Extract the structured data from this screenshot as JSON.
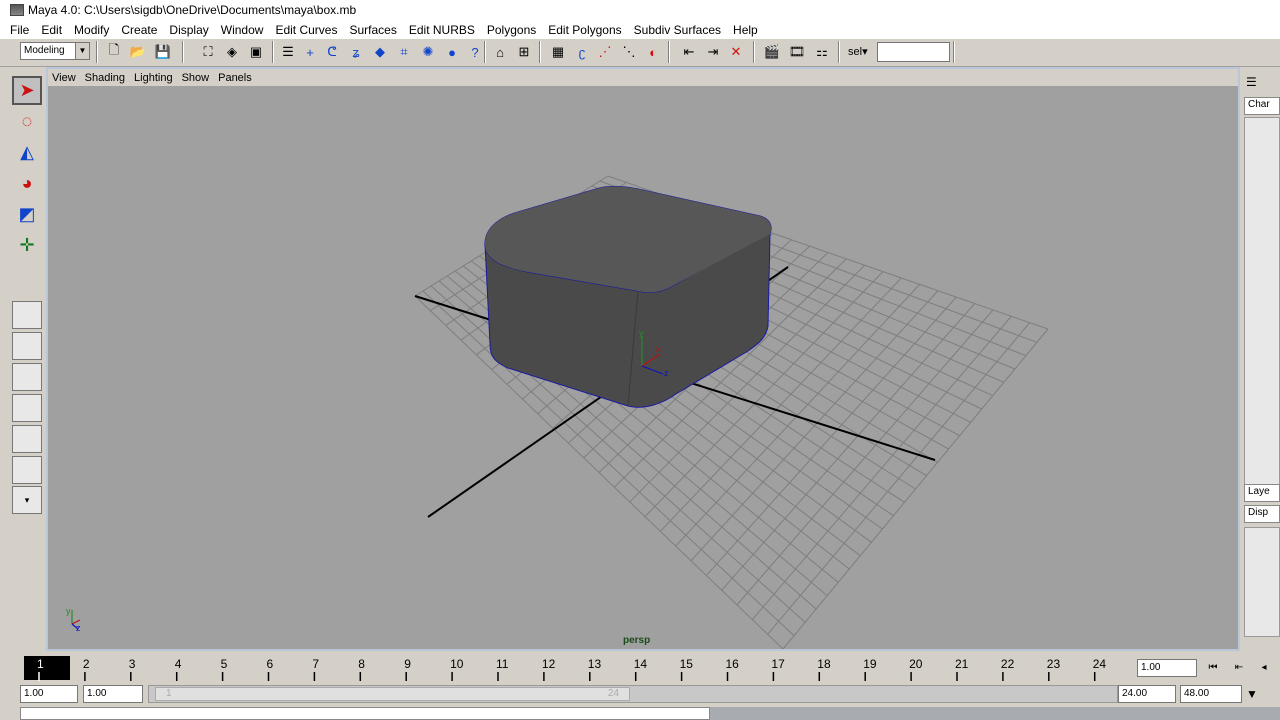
{
  "window": {
    "title": "Maya 4.0: C:\\Users\\sigdb\\OneDrive\\Documents\\maya\\box.mb"
  },
  "menubar": [
    "File",
    "Edit",
    "Modify",
    "Create",
    "Display",
    "Window",
    "Edit Curves",
    "Surfaces",
    "Edit NURBS",
    "Polygons",
    "Edit Polygons",
    "Subdiv Surfaces",
    "Help"
  ],
  "shelf": {
    "mode": "Modeling",
    "sel_label": "sel",
    "sel_value": ""
  },
  "panel_menu": [
    "View",
    "Shading",
    "Lighting",
    "Show",
    "Panels"
  ],
  "viewport": {
    "camera_label": "persp"
  },
  "right_panel": {
    "channel_tab": "Char",
    "layer_tab": "Laye",
    "display_tab": "Disp"
  },
  "timeline": {
    "current_frame": "1",
    "ticks": [
      "1",
      "2",
      "3",
      "4",
      "5",
      "6",
      "7",
      "8",
      "9",
      "10",
      "11",
      "12",
      "13",
      "14",
      "15",
      "16",
      "17",
      "18",
      "19",
      "20",
      "21",
      "22",
      "23",
      "24"
    ],
    "current_time_field": "1.00"
  },
  "range": {
    "start_time": "1.00",
    "playback_start": "1.00",
    "playback_end": "24.00",
    "end_time": "48.00",
    "slider_start": "1",
    "slider_end": "24"
  },
  "colors": {
    "viewport_bg": "#a0a0a0",
    "box_fill": "#4a4a4a",
    "grid": "#808080",
    "axis": "#000000",
    "selection": "#1a1aa0"
  }
}
